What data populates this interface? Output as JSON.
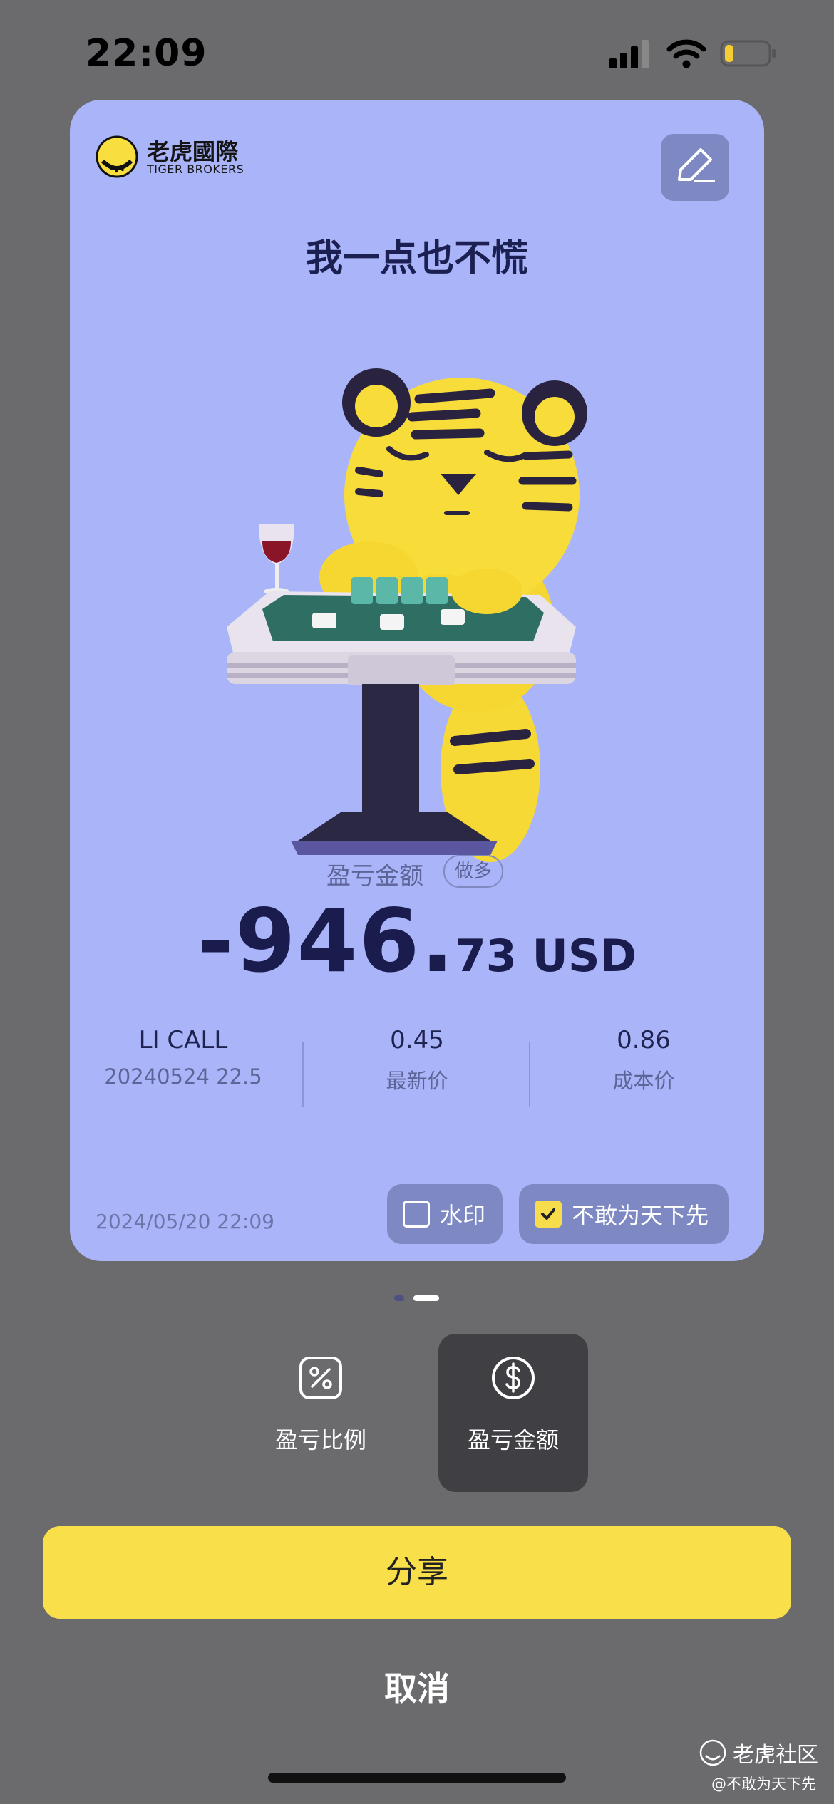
{
  "status_bar": {
    "time": "22:09",
    "battery_level": 0.2
  },
  "card": {
    "logo_cn": "老虎國際",
    "logo_en": "TIGER BROKERS",
    "edit_icon": "edit-pencil-icon",
    "headline": "我一点也不慌",
    "illustration": "tiger-mahjong-table",
    "pl_label": "盈亏金额",
    "pl_badge": "做多",
    "amount_int": "-946.",
    "amount_dec": "73 USD",
    "stats": [
      {
        "v1": "LI CALL",
        "v2": "20240524  22.5"
      },
      {
        "v1": "0.45",
        "v2": "最新价"
      },
      {
        "v1": "0.86",
        "v2": "成本价"
      }
    ],
    "date": "2024/05/20 22:09",
    "watermark_toggle": {
      "label": "水印",
      "checked": false
    },
    "name_toggle": {
      "label": "不敢为天下先",
      "checked": true
    }
  },
  "pager": {
    "page": 2,
    "total": 2
  },
  "tabs": [
    {
      "label": "盈亏比例",
      "icon": "percent-icon",
      "active": false
    },
    {
      "label": "盈亏金额",
      "icon": "dollar-icon",
      "active": true
    }
  ],
  "share_label": "分享",
  "cancel_label": "取消",
  "watermark": {
    "title": "老虎社区",
    "user": "@不敢为天下先"
  },
  "colors": {
    "card_bg": "#aab5f9",
    "accent_yellow": "#f9e04b",
    "backdrop": "#6b6b6e"
  }
}
